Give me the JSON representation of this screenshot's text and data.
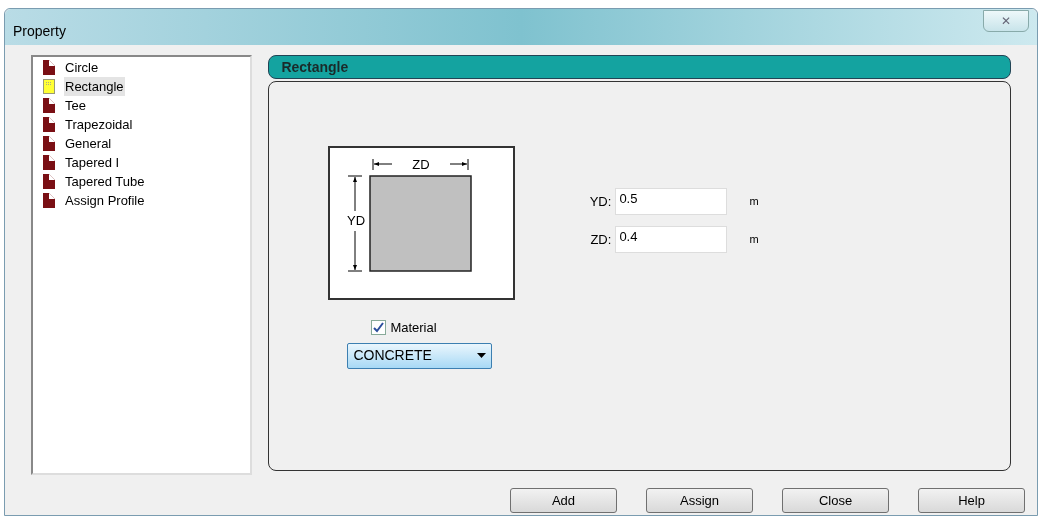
{
  "window": {
    "title": "Property",
    "close_label": "✕"
  },
  "profile_list": [
    {
      "label": "Circle",
      "selected": false
    },
    {
      "label": "Rectangle",
      "selected": true
    },
    {
      "label": "Tee",
      "selected": false
    },
    {
      "label": "Trapezoidal",
      "selected": false
    },
    {
      "label": "General",
      "selected": false
    },
    {
      "label": "Tapered I",
      "selected": false
    },
    {
      "label": "Tapered Tube",
      "selected": false
    },
    {
      "label": "Assign Profile",
      "selected": false
    }
  ],
  "section": {
    "title": "Rectangle",
    "diagram": {
      "width_label": "ZD",
      "height_label": "YD"
    },
    "fields": [
      {
        "label": "YD:",
        "value": "0.5",
        "unit": "m"
      },
      {
        "label": "ZD:",
        "value": "0.4",
        "unit": "m"
      }
    ],
    "material": {
      "label": "Material",
      "checked": true,
      "value": "CONCRETE"
    }
  },
  "buttons": [
    "Add",
    "Assign",
    "Close",
    "Help"
  ]
}
